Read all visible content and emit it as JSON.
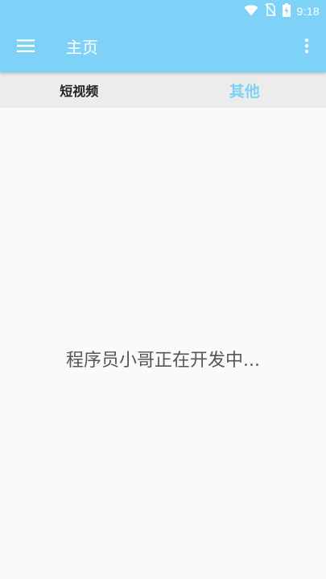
{
  "status_bar": {
    "time": "9:18",
    "icons": [
      "wifi-icon",
      "no-sim-icon",
      "battery-charging-icon"
    ]
  },
  "app_bar": {
    "title": "主页",
    "menu_icon": "hamburger-menu-icon",
    "more_icon": "more-vertical-icon"
  },
  "tabs": [
    {
      "label": "短视频",
      "selected": false
    },
    {
      "label": "其他",
      "selected": true
    }
  ],
  "content": {
    "message": "程序员小哥正在开发中..."
  },
  "colors": {
    "primary": "#7fd2f7",
    "tab_bar_bg": "#ececec",
    "background": "#fafafa",
    "message_text": "#555555"
  }
}
